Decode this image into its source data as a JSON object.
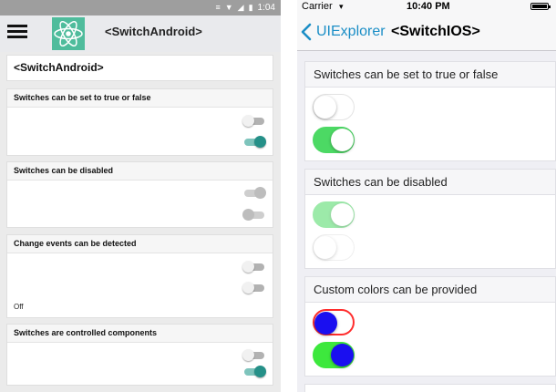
{
  "android": {
    "status": {
      "time": "1:04",
      "glyphs": [
        "≡",
        "▼",
        "◢",
        "▮"
      ]
    },
    "toolbar": {
      "title": "<SwitchAndroid>",
      "menu_icon": "hamburger-menu-icon",
      "logo_icon": "react-logo-icon"
    },
    "page_title": "<SwitchAndroid>",
    "colors": {
      "accent": "#259088",
      "accent_track": "#7ec4bc",
      "logo_bg": "#4fbc9c",
      "statusbar": "#9e9e9e"
    },
    "sections": [
      {
        "title": "Switches can be set to true or false",
        "switches": [
          {
            "value": false,
            "disabled": false
          },
          {
            "value": true,
            "disabled": false
          }
        ]
      },
      {
        "title": "Switches can be disabled",
        "switches": [
          {
            "value": true,
            "disabled": true
          },
          {
            "value": false,
            "disabled": true
          }
        ]
      },
      {
        "title": "Change events can be detected",
        "switches": [
          {
            "value": false,
            "disabled": false
          },
          {
            "value": false,
            "disabled": false
          }
        ],
        "label": "Off"
      },
      {
        "title": "Switches are controlled components",
        "switches": [
          {
            "value": false,
            "disabled": false
          },
          {
            "value": true,
            "disabled": false
          }
        ]
      }
    ]
  },
  "ios": {
    "status": {
      "carrier": "Carrier",
      "wifi_icon": "▾",
      "time": "10:40 PM"
    },
    "navbar": {
      "back_label": "UIExplorer",
      "title": "<SwitchIOS>",
      "back_icon": "chevron-left-icon"
    },
    "colors": {
      "tint": "#1b8ec6",
      "on_color": "#4cd964"
    },
    "sections": [
      {
        "title": "Switches can be set to true or false",
        "switches": [
          {
            "value": false,
            "disabled": false
          },
          {
            "value": true,
            "disabled": false
          }
        ]
      },
      {
        "title": "Switches can be disabled",
        "switches": [
          {
            "value": true,
            "disabled": true
          },
          {
            "value": false,
            "disabled": true
          }
        ]
      },
      {
        "title": "Custom colors can be provided",
        "switches": [
          {
            "value": false,
            "disabled": false,
            "track_color": "#ff2d2d",
            "thumb_color": "#1a0ff0"
          },
          {
            "value": true,
            "disabled": false,
            "track_color": "#3de83d",
            "thumb_color": "#1a0ff0"
          }
        ]
      }
    ]
  }
}
